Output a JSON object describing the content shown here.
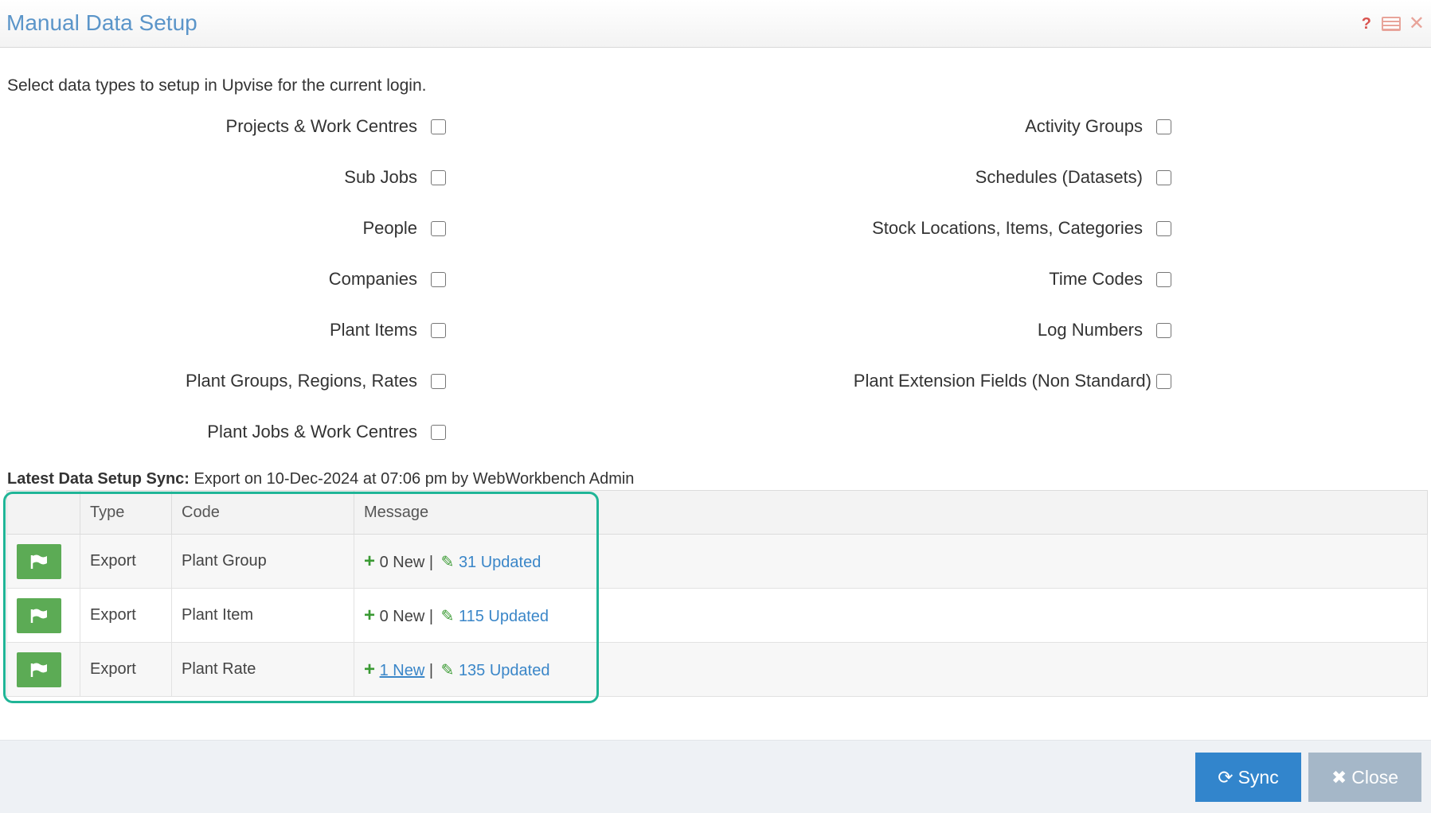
{
  "window": {
    "title": "Manual Data Setup",
    "help_icon": "question-icon",
    "list_icon": "list-icon",
    "close_icon": "close-icon"
  },
  "intro_text": "Select data types to setup in Upvise for the current login.",
  "options": {
    "left": [
      {
        "label": "Projects & Work Centres",
        "checked": false
      },
      {
        "label": "Sub Jobs",
        "checked": false
      },
      {
        "label": "People",
        "checked": false
      },
      {
        "label": "Companies",
        "checked": false
      },
      {
        "label": "Plant Items",
        "checked": false
      },
      {
        "label": "Plant Groups, Regions, Rates",
        "checked": false
      },
      {
        "label": "Plant Jobs & Work Centres",
        "checked": false
      }
    ],
    "right": [
      {
        "label": "Activity Groups",
        "checked": false
      },
      {
        "label": "Schedules (Datasets)",
        "checked": false
      },
      {
        "label": "Stock Locations, Items, Categories",
        "checked": false
      },
      {
        "label": "Time Codes",
        "checked": false
      },
      {
        "label": "Log Numbers",
        "checked": false
      },
      {
        "label": "Plant Extension Fields (Non Standard)",
        "checked": false
      }
    ]
  },
  "latest_sync": {
    "label": "Latest Data Setup Sync:",
    "text": "Export on 10-Dec-2024 at 07:06 pm by WebWorkbench Admin"
  },
  "table": {
    "columns": [
      "",
      "Type",
      "Code",
      "Message"
    ],
    "rows": [
      {
        "icon": "flag-icon",
        "type": "Export",
        "code": "Plant Group",
        "new_text": "0 New",
        "updated_text": "31 Updated"
      },
      {
        "icon": "flag-icon",
        "type": "Export",
        "code": "Plant Item",
        "new_text": "0 New",
        "updated_text": "115 Updated"
      },
      {
        "icon": "flag-icon",
        "type": "Export",
        "code": "Plant Rate",
        "new_text": "1 New",
        "updated_text": "135 Updated"
      }
    ],
    "separator": "|"
  },
  "buttons": {
    "sync": "Sync",
    "close": "Close"
  },
  "colors": {
    "title": "#5b95c9",
    "highlight": "#20b597",
    "sync_button": "#3285cc",
    "close_button": "#a5b7c8",
    "flag": "#5cab55"
  }
}
